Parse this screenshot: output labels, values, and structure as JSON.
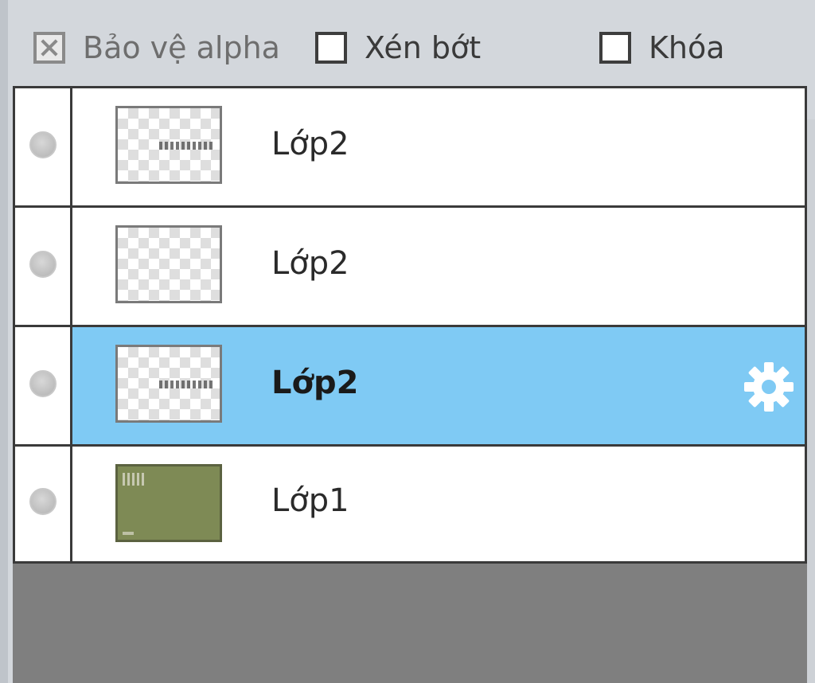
{
  "options": {
    "alpha_protect": {
      "label": "Bảo vệ alpha",
      "checked": false,
      "disabled": true
    },
    "clip": {
      "label": "Xén bớt",
      "checked": false
    },
    "lock": {
      "label": "Khóa",
      "checked": false
    }
  },
  "layers": [
    {
      "name": "Lớp2",
      "visible": true,
      "selected": false,
      "thumbnail": "transparent-with-scribble"
    },
    {
      "name": "Lớp2",
      "visible": true,
      "selected": false,
      "thumbnail": "transparent"
    },
    {
      "name": "Lớp2",
      "visible": true,
      "selected": true,
      "thumbnail": "transparent-with-scribble",
      "icon": "gear-icon"
    },
    {
      "name": "Lớp1",
      "visible": true,
      "selected": false,
      "thumbnail": "olive-solid"
    }
  ],
  "colors": {
    "selected_row": "#7fcaf4",
    "empty_area": "#7f7f7f",
    "panel_bg": "#d3d7dc"
  }
}
